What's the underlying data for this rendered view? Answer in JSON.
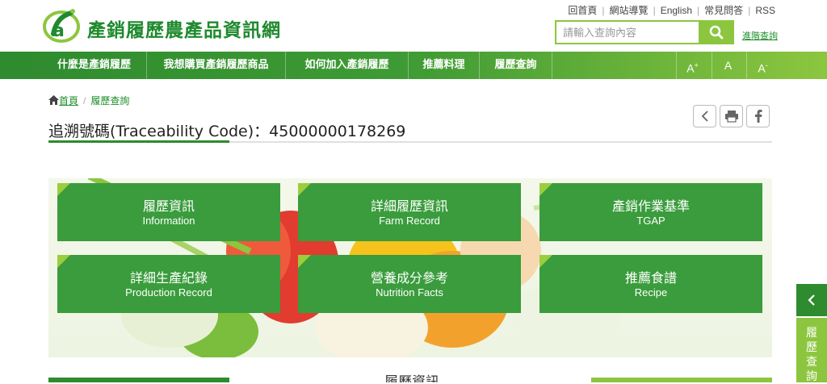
{
  "header": {
    "site_title": "產銷履歷農產品資訊網",
    "top_links": [
      "回首頁",
      "網站導覽",
      "English",
      "常見問答",
      "RSS"
    ],
    "search_placeholder": "請輸入查詢內容",
    "advanced_search": "進階查詢"
  },
  "nav": {
    "items": [
      "什麼是產銷履歷",
      "我想購買產銷履歷商品",
      "如何加入產銷履歷",
      "推薦料理",
      "履歷查詢"
    ],
    "font_sizes": [
      "A",
      "A",
      "A"
    ],
    "font_size_marks": [
      "+",
      "",
      "-"
    ]
  },
  "breadcrumb": {
    "home": "首頁",
    "current": "履歷查詢"
  },
  "page_title": "追溯號碼(Traceability Code)：45000000178269",
  "tiles": [
    {
      "zh": "履歷資訊",
      "en": "Information"
    },
    {
      "zh": "詳細履歷資訊",
      "en": "Farm Record"
    },
    {
      "zh": "產銷作業基準",
      "en": "TGAP"
    },
    {
      "zh": "詳細生產紀錄",
      "en": "Production Record"
    },
    {
      "zh": "營養成分參考",
      "en": "Nutrition Facts"
    },
    {
      "zh": "推薦食譜",
      "en": "Recipe"
    }
  ],
  "bottom_heading": "履歷資訊",
  "side_tab": "履歷查詢",
  "colors": {
    "primary_green": "#2e8b2e",
    "light_green": "#8cc63f",
    "tile_green": "#3a9c3c"
  }
}
